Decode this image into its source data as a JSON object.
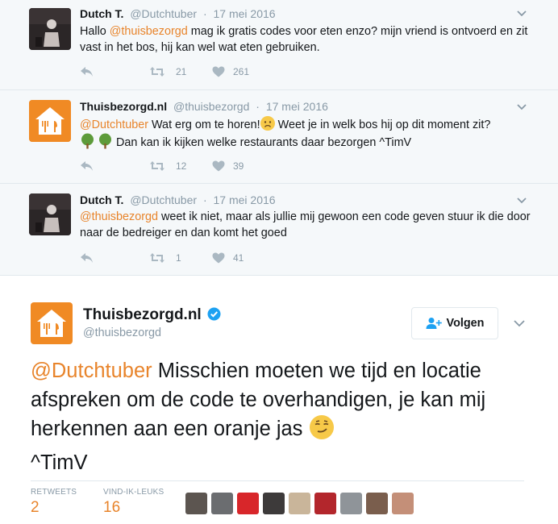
{
  "replies": [
    {
      "name": "Dutch T.",
      "handle": "@Dutchtuber",
      "date": "17 mei 2016",
      "text_before": "Hallo ",
      "mention": "@thuisbezorgd",
      "text_after": " mag ik gratis codes voor eten enzo? mijn vriend is ontvoerd en zit vast in het bos, hij kan wel wat eten gebruiken.",
      "retweets": "21",
      "likes": "261"
    },
    {
      "name": "Thuisbezorgd.nl",
      "handle": "@thuisbezorgd",
      "date": "17 mei 2016",
      "mention": "@Dutchtuber",
      "text_line1": " Wat erg om te horen!",
      "text_line1b": " Weet je in welk bos hij op dit moment zit?",
      "text_line2": " Dan kan ik kijken welke restaurants daar bezorgen ^TimV",
      "retweets": "12",
      "likes": "39"
    },
    {
      "name": "Dutch T.",
      "handle": "@Dutchtuber",
      "date": "17 mei 2016",
      "mention": "@thuisbezorgd",
      "text_after": " weet ik niet, maar als jullie mij gewoon een code geven stuur ik die door naar de bedreiger en dan komt het goed",
      "retweets": "1",
      "likes": "41"
    }
  ],
  "main_tweet": {
    "name": "Thuisbezorgd.nl",
    "handle": "@thuisbezorgd",
    "follow_label": "Volgen",
    "mention": "@Dutchtuber",
    "text": " Misschien moeten we tijd en locatie afspreken om de code te overhandigen, je kan mij herkennen aan een oranje jas ",
    "signature": "^TimV",
    "retweets_label": "RETWEETS",
    "retweets": "2",
    "likes_label": "VIND-IK-LEUKS",
    "likes": "16"
  },
  "colors": {
    "accent": "#e8842b",
    "brand_orange": "#f08a24",
    "verified": "#1da1f2",
    "muted": "#8899a6",
    "reply_bg": "#f5f8fa"
  },
  "icons": [
    "reply-icon",
    "retweet-icon",
    "heart-icon",
    "chevron-down-icon",
    "verified-icon",
    "follow-person-icon"
  ]
}
